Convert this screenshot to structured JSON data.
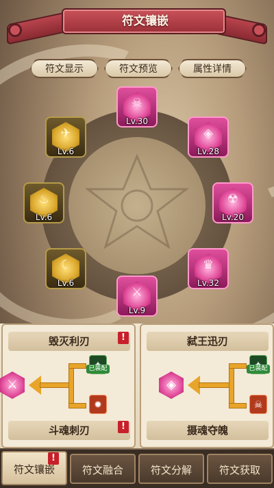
{
  "title": "符文镶嵌",
  "tabs": [
    "符文显示",
    "符文预览",
    "属性详情"
  ],
  "runes": [
    {
      "id": "top",
      "color": "pink",
      "icon": "skull-icon",
      "glyph": "☠",
      "level": "Lv.30"
    },
    {
      "id": "right-upper",
      "color": "pink",
      "icon": "shield-icon",
      "glyph": "◈",
      "level": "Lv.28"
    },
    {
      "id": "right-middle",
      "color": "pink",
      "icon": "demon-icon",
      "glyph": "☢",
      "level": "Lv.20"
    },
    {
      "id": "right-lower",
      "color": "pink",
      "icon": "crest-icon",
      "glyph": "♛",
      "level": "Lv.32"
    },
    {
      "id": "bottom",
      "color": "pink",
      "icon": "sword-icon",
      "glyph": "⚔",
      "level": "Lv.9"
    },
    {
      "id": "left-upper",
      "color": "gold",
      "icon": "bird-icon",
      "glyph": "✈",
      "level": "Lv.6"
    },
    {
      "id": "left-middle",
      "color": "gold",
      "icon": "flame-icon",
      "glyph": "♨",
      "level": "Lv.6"
    },
    {
      "id": "left-lower",
      "color": "gold",
      "icon": "moon-icon",
      "glyph": "☾",
      "level": "Lv.6"
    }
  ],
  "cards": {
    "left": {
      "title": "毁灭利刃",
      "subtitle": "斗魂刺刃",
      "equipped_label": "已装配"
    },
    "right": {
      "title": "弑王迅刃",
      "subtitle": "摄魂夺魄",
      "equipped_label": "已装配"
    }
  },
  "alert_mark": "!",
  "nav": [
    "符文镶嵌",
    "符文融合",
    "符文分解",
    "符文获取"
  ],
  "colors": {
    "banner": "#b03a44",
    "pink_rune": "#e04797",
    "gold_rune": "#d9a52a",
    "arrow": "#e8a52a"
  }
}
